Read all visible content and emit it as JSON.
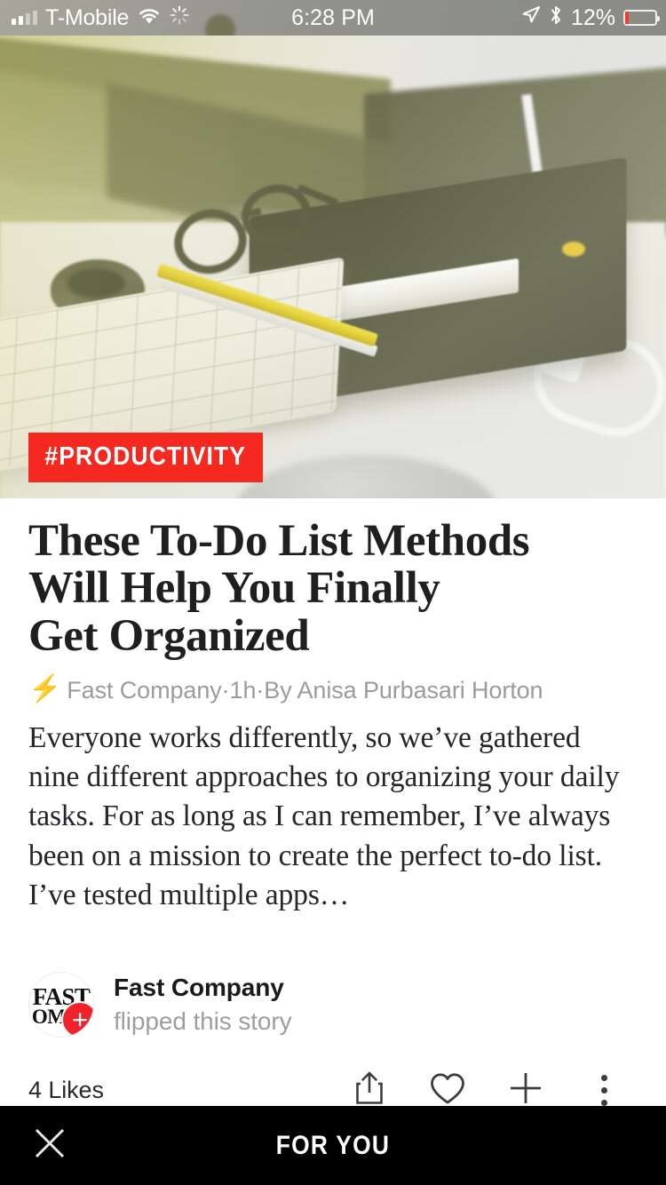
{
  "status_bar": {
    "carrier": "T-Mobile",
    "signal_bars_filled": 2,
    "signal_bars_total": 4,
    "wifi_icon": "wifi-icon",
    "activity_icon": "activity-spinner-icon",
    "time": "6:28 PM",
    "location_icon": "location-arrow-icon",
    "bluetooth_icon": "bluetooth-icon",
    "battery_percent": "12%",
    "battery_level": 12,
    "battery_color": "#f5392e"
  },
  "hero": {
    "image_alt": "desk with keyboard, eyeglasses, black notebook and yellow pencil",
    "tag_label": "#PRODUCTIVITY",
    "tag_color": "#f5291f"
  },
  "article": {
    "headline": "These To-Do List Methods\nWill Help You Finally\nGet Organized",
    "bolt_icon": "lightning-bolt-icon",
    "source": "Fast Company",
    "separator_1": " · ",
    "time_ago": "1h",
    "separator_2": " · ",
    "author": "By Anisa Purbasari Horton",
    "excerpt": "Everyone works differently, so we’ve gathered nine different approaches to organizing your daily tasks. For as long as I can remember, I’ve always been on a mission to create the perfect to-do list. I’ve tested multiple apps…"
  },
  "attribution": {
    "avatar_line_1": "FAST",
    "avatar_line_2": "OMPA",
    "avatar_badge": "+",
    "name": "Fast Company",
    "action_text": "flipped this story"
  },
  "actions": {
    "likes": "4 Likes",
    "share_icon": "share-icon",
    "like_icon": "heart-icon",
    "add_icon": "plus-icon",
    "more_icon": "more-vertical-icon"
  },
  "footer": {
    "close_icon": "close-x-icon",
    "title": "FOR YOU",
    "background": "#000000"
  }
}
